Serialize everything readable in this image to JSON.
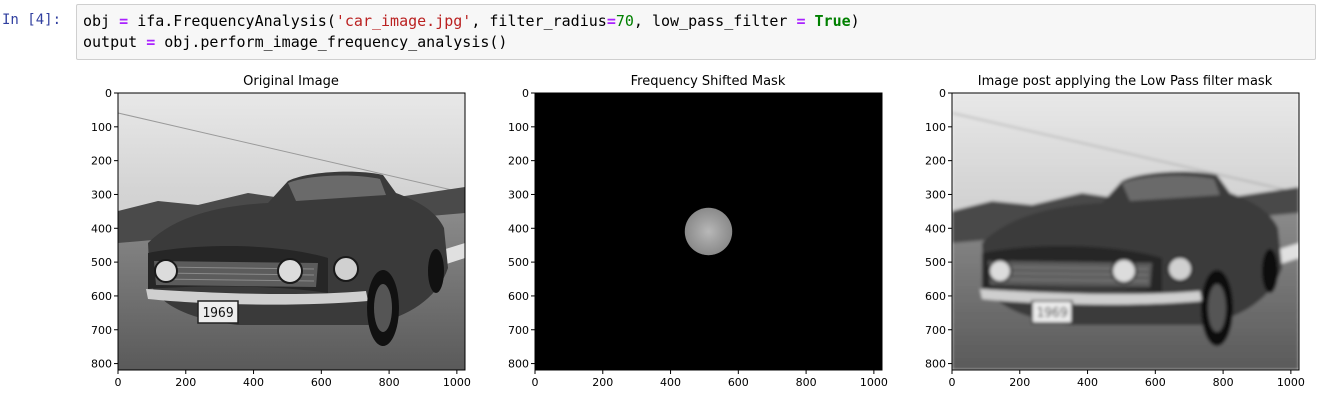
{
  "cell": {
    "prompt": "In [4]:",
    "line1": {
      "a": "obj",
      "eq": "=",
      "b": "ifa.FrequencyAnalysis(",
      "str": "'car_image.jpg'",
      "c": ", filter_radius",
      "eq2": "=",
      "num": "70",
      "d": ", low_pass_filter ",
      "eq3": "=",
      "sp": " ",
      "bool": "True",
      "e": ")"
    },
    "line2": {
      "a": "output ",
      "eq": "=",
      "b": " obj.perform_image_frequency_analysis()"
    }
  },
  "panels": [
    {
      "title": "Original Image",
      "xticks": [
        "0",
        "200",
        "400",
        "600",
        "800",
        "1000"
      ],
      "yticks": [
        "0",
        "100",
        "200",
        "300",
        "400",
        "500",
        "600",
        "700",
        "800"
      ]
    },
    {
      "title": "Frequency Shifted Mask",
      "xticks": [
        "0",
        "200",
        "400",
        "600",
        "800",
        "1000"
      ],
      "yticks": [
        "0",
        "100",
        "200",
        "300",
        "400",
        "500",
        "600",
        "700",
        "800"
      ]
    },
    {
      "title": "Image post applying the Low Pass filter mask",
      "xticks": [
        "0",
        "200",
        "400",
        "600",
        "800",
        "1000"
      ],
      "yticks": [
        "0",
        "100",
        "200",
        "300",
        "400",
        "500",
        "600",
        "700",
        "800"
      ]
    }
  ],
  "image_extent": {
    "width": 1024,
    "height": 819
  },
  "mask": {
    "radius": 70
  },
  "plate_text": "1969"
}
